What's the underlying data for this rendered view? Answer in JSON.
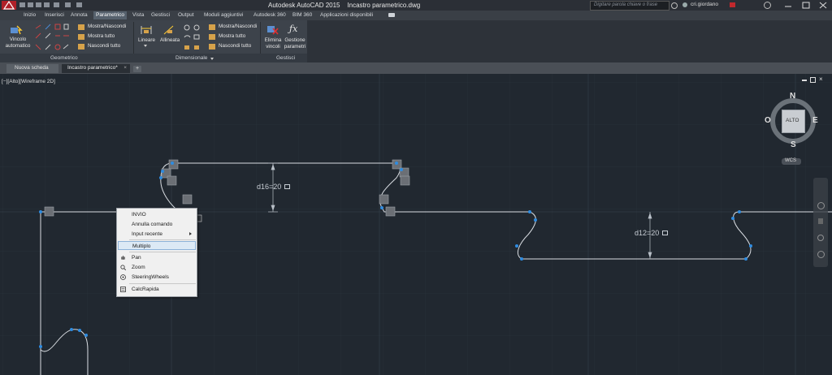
{
  "window": {
    "title": "Autodesk AutoCAD 2015    Incastro parametrico.dwg",
    "search_placeholder": "Digitare parola chiave o frase",
    "user": "cri.giordano"
  },
  "menu": {
    "items": [
      "Inizio",
      "Inserisci",
      "Annota",
      "Parametrico",
      "Vista",
      "Gestisci",
      "Output",
      "Moduli aggiuntivi",
      "Autodesk 360",
      "BIM 360",
      "Applicazioni disponibili"
    ],
    "active": "Parametrico"
  },
  "ribbon": {
    "geometrico": {
      "title": "Geometrico",
      "auto_constraint": "Vincolo automatico",
      "show_hide": "Mostra/Nascondi",
      "show_all": "Mostra tutto",
      "hide_all": "Nascondi tutto"
    },
    "dimensionale": {
      "title": "Dimensionale",
      "linear": "Lineare",
      "aligned": "Allineata",
      "show_hide": "Mostra/Nascondi",
      "show_all": "Mostra tutto",
      "hide_all": "Nascondi tutto"
    },
    "gestisci": {
      "title": "Gestisci",
      "delete_constraints": "Elimina vincoli",
      "param_manager": "Gestione parametri"
    }
  },
  "doc_tabs": {
    "items": [
      "Nuova scheda",
      "Incastro parametrico*"
    ],
    "active": "Incastro parametrico*"
  },
  "viewport": {
    "label": "[−][Alto][Wireframe 2D]",
    "viewcube": {
      "n": "N",
      "s": "S",
      "e": "E",
      "o": "O",
      "face": "ALTO",
      "ucs": "WCS"
    },
    "dim1": "d16=20",
    "dim2": "d12=20"
  },
  "context_menu": {
    "items": [
      {
        "label": "INVIO",
        "icon": ""
      },
      {
        "label": "Annulla comando",
        "icon": ""
      },
      {
        "label": "Input recente",
        "icon": "arrow-right"
      },
      {
        "label": "Multiplo",
        "icon": "",
        "selected": true
      },
      {
        "label": "Pan",
        "icon": "pan-hand-icon"
      },
      {
        "label": "Zoom",
        "icon": "zoom-magnifier-icon"
      },
      {
        "label": "SteeringWheels",
        "icon": "steering-wheel-icon"
      },
      {
        "label": "CalcRapida",
        "icon": "calculator-icon"
      }
    ]
  },
  "colors": {
    "canvas_bg": "#212830",
    "geometry": "#d9dde2",
    "grip": "#2f8ce0",
    "accent_red": "#c0282d"
  }
}
